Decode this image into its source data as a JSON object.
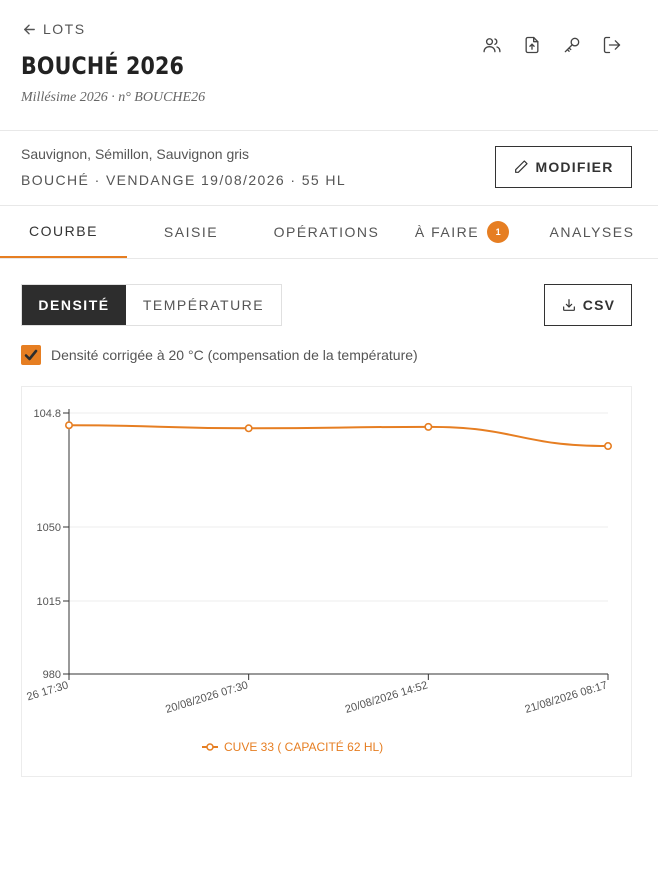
{
  "header": {
    "back_label": "LOTS",
    "title": "BOUCHÉ 2026",
    "subtitle": "Millésime 2026 · n° BOUCHE26",
    "actions": [
      "users-icon",
      "upload-icon",
      "key-icon",
      "logout-icon"
    ]
  },
  "info": {
    "grapes": "Sauvignon, Sémillon, Sauvignon gris",
    "meta": "BOUCHÉ · VENDANGE 19/08/2026 · 55 HL",
    "modify_label": "MODIFIER"
  },
  "tabs": [
    {
      "label": "COURBE",
      "active": true
    },
    {
      "label": "SAISIE",
      "active": false
    },
    {
      "label": "OPÉRATIONS",
      "active": false
    },
    {
      "label": "À FAIRE",
      "active": false,
      "badge": "1"
    },
    {
      "label": "ANALYSES",
      "active": false
    }
  ],
  "segment": {
    "density_label": "DENSITÉ",
    "temperature_label": "TEMPÉRATURE"
  },
  "csv_label": "CSV",
  "correction": {
    "checked": true,
    "label": "Densité corrigée à 20 °C (compensation de la température)"
  },
  "colors": {
    "accent": "#e67e22",
    "dark": "#2d2d2d"
  },
  "chart_data": {
    "type": "line",
    "y_ticks": [
      "980",
      "1015",
      "1050",
      "104.8"
    ],
    "x": [
      "26 17:30",
      "20/08/2026 07:30",
      "20/08/2026 14:52",
      "21/08/2026 08:17"
    ],
    "series": [
      {
        "name": "CUVE 33 ( CAPACITÉ 62 HL)",
        "color": "#e67e22",
        "values": [
          1102,
          1100.5,
          1101.2,
          1091.8
        ]
      }
    ],
    "ylim": [
      980,
      1108
    ],
    "grid": true,
    "legend": "bottom"
  }
}
